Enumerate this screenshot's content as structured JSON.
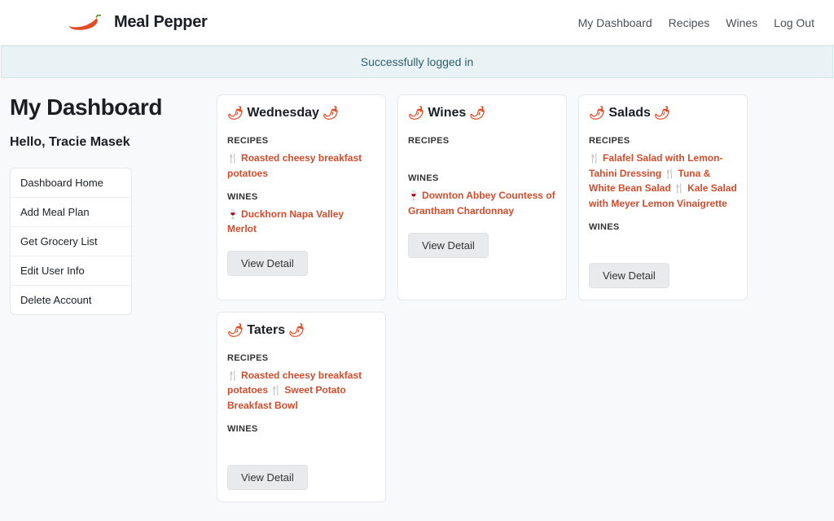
{
  "brand": "Meal Pepper",
  "nav": {
    "dashboard": "My Dashboard",
    "recipes": "Recipes",
    "wines": "Wines",
    "logout": "Log Out"
  },
  "banner": "Successfully logged in",
  "page_title": "My Dashboard",
  "greeting": "Hello, Tracie Masek",
  "side_items": [
    "Dashboard Home",
    "Add Meal Plan",
    "Get Grocery List",
    "Edit User Info",
    "Delete Account"
  ],
  "labels": {
    "recipes": "RECIPES",
    "wines": "WINES",
    "view_detail": "View Detail"
  },
  "cards": [
    {
      "title": "Wednesday",
      "recipes": [
        "Roasted cheesy breakfast potatoes"
      ],
      "wines": [
        "Duckhorn Napa Valley Merlot"
      ]
    },
    {
      "title": "Wines",
      "recipes": [],
      "wines": [
        "Downton Abbey Countess of Grantham Chardonnay"
      ]
    },
    {
      "title": "Salads",
      "recipes": [
        "Falafel Salad with Lemon-Tahini Dressing",
        "Tuna & White Bean Salad",
        "Kale Salad with Meyer Lemon Vinaigrette"
      ],
      "wines": []
    },
    {
      "title": "Taters",
      "recipes": [
        "Roasted cheesy breakfast potatoes",
        "Sweet Potato Breakfast Bowl"
      ],
      "wines": []
    }
  ]
}
